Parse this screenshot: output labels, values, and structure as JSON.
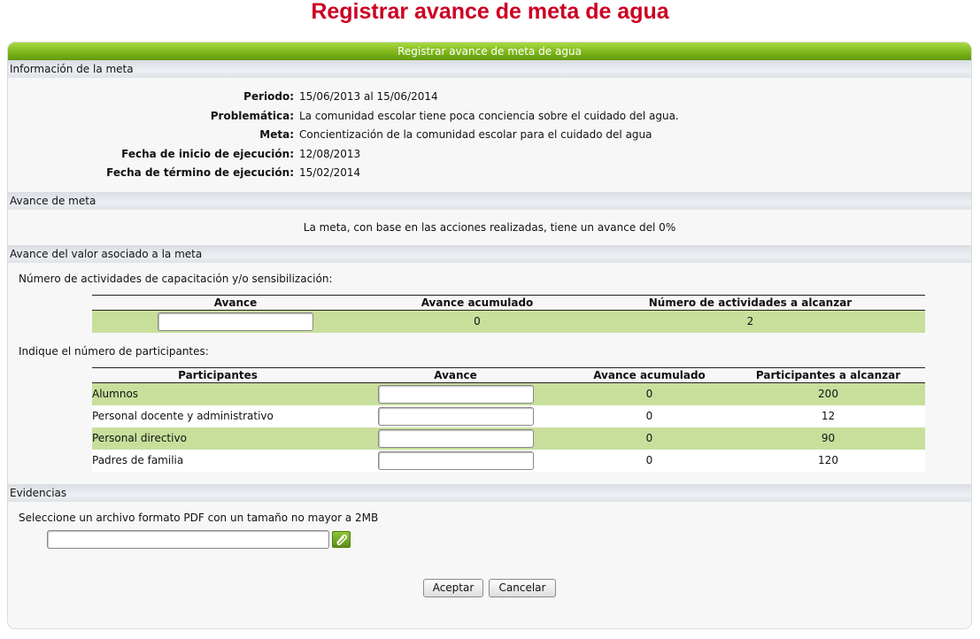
{
  "page": {
    "title": "Registrar avance de meta de agua"
  },
  "panel": {
    "header": "Registrar avance de meta de agua"
  },
  "info_section": {
    "title": "Información de la meta",
    "rows": [
      {
        "label": "Periodo:",
        "value": "15/06/2013 al 15/06/2014"
      },
      {
        "label": "Problemática:",
        "value": "La comunidad escolar tiene poca conciencia sobre el cuidado del agua."
      },
      {
        "label": "Meta:",
        "value": "Concientización de la comunidad escolar para el cuidado del agua"
      },
      {
        "label": "Fecha de inicio de ejecución:",
        "value": "12/08/2013"
      },
      {
        "label": "Fecha de término de ejecución:",
        "value": "15/02/2014"
      }
    ]
  },
  "progress_section": {
    "title": "Avance de meta",
    "text": "La meta, con base en las acciones realizadas, tiene un avance del 0%"
  },
  "value_section": {
    "title": "Avance del valor asociado a la meta",
    "activities_label": "Número de actividades de capacitación y/o sensibilización:",
    "activities_table": {
      "headers": [
        "Avance",
        "Avance acumulado",
        "Número de actividades a alcanzar"
      ],
      "row": {
        "avance": "",
        "acumulado": "0",
        "alcanzar": "2"
      }
    },
    "participants_label": "Indique el número de participantes:",
    "participants_table": {
      "headers": [
        "Participantes",
        "Avance",
        "Avance acumulado",
        "Participantes a alcanzar"
      ],
      "rows": [
        {
          "name": "Alumnos",
          "avance": "",
          "acumulado": "0",
          "alcanzar": "200"
        },
        {
          "name": "Personal docente y administrativo",
          "avance": "",
          "acumulado": "0",
          "alcanzar": "12"
        },
        {
          "name": "Personal directivo",
          "avance": "",
          "acumulado": "0",
          "alcanzar": "90"
        },
        {
          "name": "Padres de familia",
          "avance": "",
          "acumulado": "0",
          "alcanzar": "120"
        }
      ]
    }
  },
  "evidence_section": {
    "title": "Evidencias",
    "instructions": "Seleccione un archivo formato PDF con un tamaño no mayor a 2MB",
    "file_value": "",
    "attach_icon": "paperclip-icon"
  },
  "actions": {
    "accept": "Aceptar",
    "cancel": "Cancelar"
  },
  "colors": {
    "title": "#cc0022",
    "header_green": "#7fb619",
    "row_green": "#c8df9c"
  }
}
